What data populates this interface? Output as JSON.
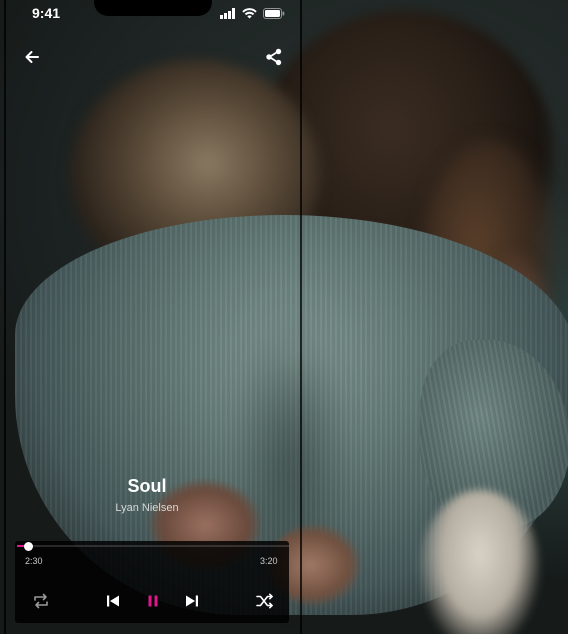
{
  "status_bar": {
    "time": "9:41",
    "icons": [
      "signal-icon",
      "wifi-icon",
      "battery-icon"
    ]
  },
  "header": {
    "back_icon": "arrow-left-icon",
    "share_icon": "share-icon"
  },
  "track": {
    "title": "Soul",
    "artist": "Lyan Nielsen"
  },
  "player": {
    "elapsed": "2:30",
    "duration": "3:20",
    "progress_fraction": 0.04,
    "controls": [
      "repeat-icon",
      "previous-icon",
      "pause-icon",
      "next-icon",
      "shuffle-icon"
    ]
  },
  "colors": {
    "accent": "#e0178a",
    "panel": "#000000",
    "text": "#ffffff"
  }
}
